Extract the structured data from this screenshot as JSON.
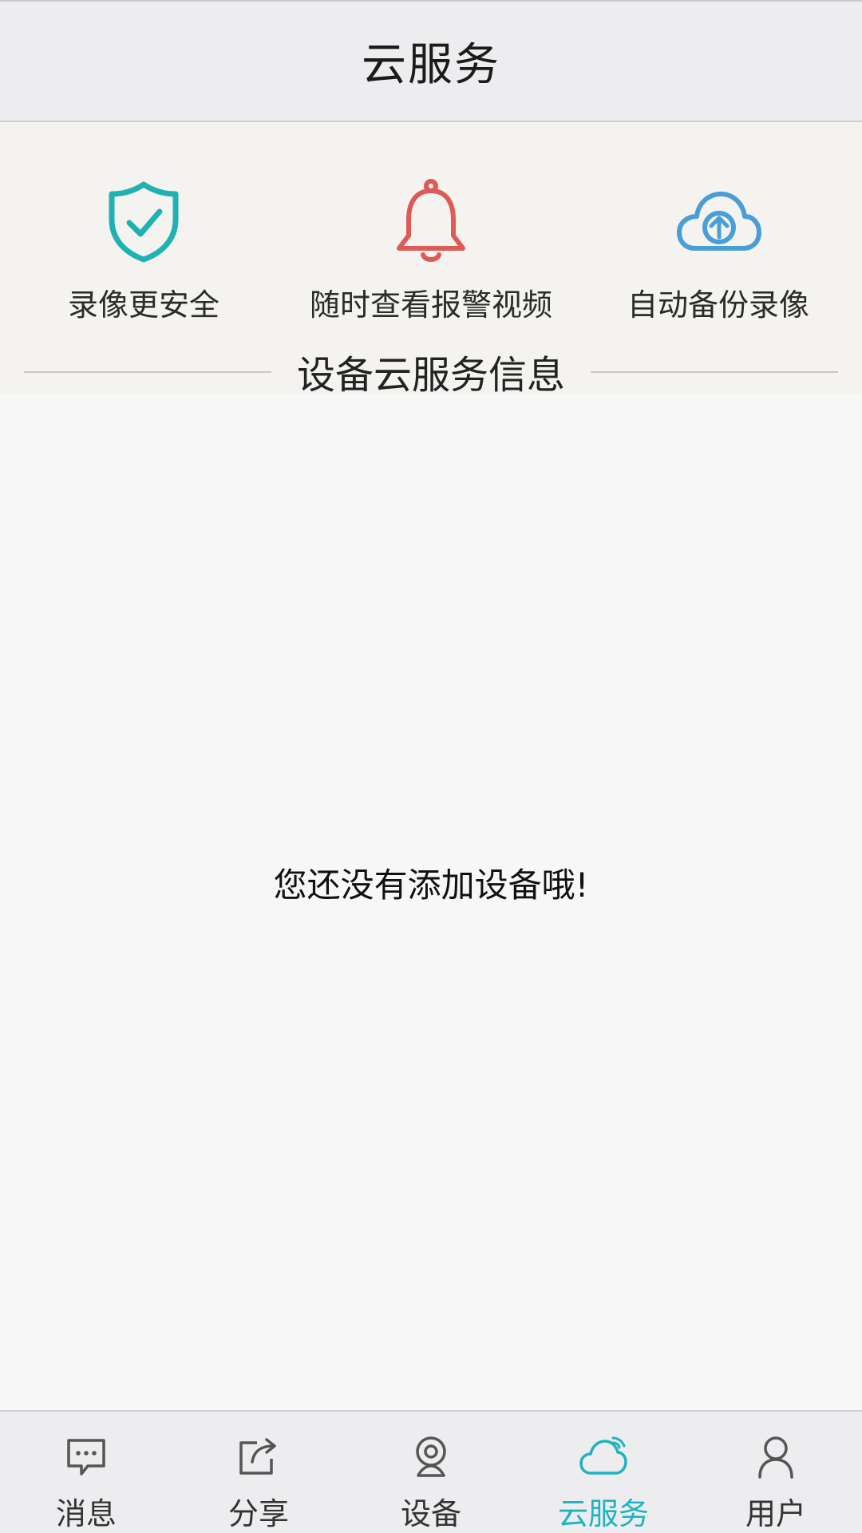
{
  "header": {
    "title": "云服务"
  },
  "features": [
    {
      "label": "录像更安全",
      "icon": "shield-check-icon",
      "color": "#1fb2b2"
    },
    {
      "label": "随时查看报警视频",
      "icon": "bell-icon",
      "color": "#e05a55"
    },
    {
      "label": "自动备份录像",
      "icon": "cloud-upload-icon",
      "color": "#4a9ed8"
    }
  ],
  "section": {
    "title": "设备云服务信息"
  },
  "empty": {
    "message": "您还没有添加设备哦!"
  },
  "nav": {
    "active": "云服务",
    "active_color": "#1fb2bf",
    "items": [
      {
        "label": "消息",
        "icon": "message-icon"
      },
      {
        "label": "分享",
        "icon": "share-icon"
      },
      {
        "label": "设备",
        "icon": "camera-icon"
      },
      {
        "label": "云服务",
        "icon": "cloud-service-icon"
      },
      {
        "label": "用户",
        "icon": "user-icon"
      }
    ]
  }
}
